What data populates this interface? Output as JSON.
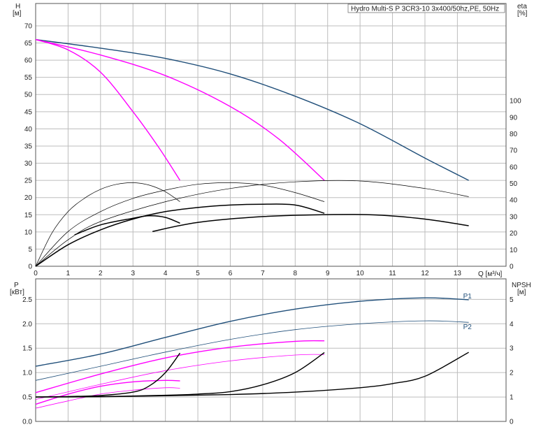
{
  "chart_data": [
    {
      "type": "line",
      "title": "Hydro Multi-S P 3CR3-10 3x400/50hz,PE, 50Hz",
      "xlabel": "Q [м³/ч]",
      "ylabel": "H",
      "ylabel_unit": "[м]",
      "y2label": "eta",
      "y2label_unit": "[%]",
      "xlim": [
        0,
        14.5
      ],
      "ylim": [
        0,
        76.5
      ],
      "y2lim": [
        0,
        100
      ],
      "x_ticks": [
        "0",
        "1",
        "2",
        "3",
        "4",
        "5",
        "6",
        "7",
        "8",
        "9",
        "10",
        "11",
        "12",
        "13"
      ],
      "y_ticks": [
        "0",
        "5",
        "10",
        "15",
        "20",
        "25",
        "30",
        "35",
        "40",
        "45",
        "50",
        "55",
        "60",
        "65",
        "70"
      ],
      "y2_ticks": [
        "0",
        "10",
        "20",
        "30",
        "40",
        "50",
        "60",
        "70",
        "80",
        "90",
        "100"
      ],
      "grid": true,
      "colors": {
        "head_main": "#1f4e79",
        "head_partial": "#ff00ff",
        "eta": "#000000"
      },
      "series": [
        {
          "role": "head",
          "x": [
            0,
            2,
            4,
            6,
            8,
            10,
            12,
            13.35
          ],
          "y": [
            66,
            63.5,
            60.5,
            56,
            49.5,
            41.5,
            31.5,
            25
          ]
        },
        {
          "role": "head",
          "x": [
            0,
            2,
            4,
            6,
            7.5,
            8.9
          ],
          "y": [
            66,
            61.5,
            55.5,
            46.5,
            37,
            25
          ]
        },
        {
          "role": "head",
          "x": [
            0,
            1,
            2,
            3,
            3.8,
            4.45
          ],
          "y": [
            66,
            63,
            56.5,
            45,
            34.5,
            25
          ]
        },
        {
          "role": "eta",
          "x": [
            0,
            1,
            2,
            4,
            6,
            8,
            10,
            12,
            13.35
          ],
          "y2": [
            0,
            16,
            27,
            39,
            47,
            51,
            51.5,
            47,
            42
          ]
        },
        {
          "role": "eta",
          "x": [
            0,
            1,
            2,
            3,
            4,
            5,
            6,
            7,
            8,
            8.9
          ],
          "y2": [
            0,
            21,
            33,
            41,
            46,
            49.5,
            50.5,
            49,
            44.5,
            39
          ]
        },
        {
          "role": "eta",
          "x": [
            0,
            0.5,
            1,
            1.5,
            2,
            2.5,
            3,
            3.5,
            4,
            4.45
          ],
          "y2": [
            0,
            20,
            33,
            41,
            46.5,
            49.5,
            50.5,
            49,
            45,
            39
          ]
        },
        {
          "role": "eta",
          "x": [
            0,
            1,
            2,
            3,
            4,
            5,
            6,
            7,
            8,
            8.9
          ],
          "y2": [
            0,
            13,
            22,
            28.5,
            33,
            35.5,
            37,
            37.5,
            37,
            32
          ]
        },
        {
          "role": "eta",
          "x": [
            1.2,
            2,
            3,
            3.5,
            4,
            4.45
          ],
          "y2": [
            19,
            25,
            29,
            30.5,
            29.5,
            26
          ]
        },
        {
          "role": "eta",
          "x": [
            3.6,
            5,
            7,
            9,
            10.5,
            12,
            13.35
          ],
          "y2": [
            21,
            26.5,
            30,
            31.2,
            31,
            28.5,
            24.5
          ]
        }
      ]
    },
    {
      "type": "line",
      "xlim": [
        0,
        14.5
      ],
      "ylabel": "P",
      "ylabel_unit": "[кВт]",
      "y2label": "NPSH",
      "y2label_unit": "[м]",
      "ylim": [
        0,
        2.92
      ],
      "y2lim": [
        0,
        5.84
      ],
      "y_ticks": [
        "0.0",
        "0.5",
        "1.0",
        "1.5",
        "2.0",
        "2.5"
      ],
      "y2_ticks": [
        "0",
        "1",
        "2",
        "3",
        "4",
        "5"
      ],
      "grid": true,
      "series": [
        {
          "name": "P1",
          "role": "power",
          "x": [
            0,
            2,
            4,
            6,
            8,
            10,
            12,
            13.35
          ],
          "y": [
            1.13,
            1.38,
            1.72,
            2.05,
            2.3,
            2.46,
            2.53,
            2.49
          ]
        },
        {
          "name": "P2",
          "role": "power",
          "x": [
            0,
            2,
            4,
            6,
            8,
            10,
            12,
            13.35
          ],
          "y": [
            0.84,
            1.13,
            1.42,
            1.68,
            1.88,
            2.0,
            2.06,
            2.03
          ]
        },
        {
          "role": "power",
          "x": [
            0,
            2,
            4,
            6,
            8,
            8.9
          ],
          "y": [
            0.59,
            0.97,
            1.3,
            1.52,
            1.64,
            1.65
          ]
        },
        {
          "role": "power",
          "x": [
            0,
            2,
            4,
            6,
            8,
            8.9
          ],
          "y": [
            0.45,
            0.76,
            1.04,
            1.24,
            1.36,
            1.37
          ]
        },
        {
          "role": "power",
          "x": [
            0,
            1,
            2,
            3,
            4,
            4.45
          ],
          "y": [
            0.35,
            0.56,
            0.72,
            0.81,
            0.84,
            0.83
          ]
        },
        {
          "role": "power",
          "x": [
            0,
            1,
            2,
            3,
            4,
            4.45
          ],
          "y": [
            0.27,
            0.42,
            0.56,
            0.64,
            0.69,
            0.68
          ]
        },
        {
          "role": "npsh",
          "x": [
            0,
            2,
            4,
            6,
            8,
            10,
            11,
            12,
            13.35
          ],
          "y2": [
            1.0,
            1.01,
            1.05,
            1.1,
            1.2,
            1.38,
            1.55,
            1.85,
            2.83
          ]
        },
        {
          "role": "npsh",
          "x": [
            0,
            2,
            4,
            5,
            6,
            7,
            8,
            8.9
          ],
          "y2": [
            1.0,
            1.02,
            1.07,
            1.12,
            1.22,
            1.5,
            2.0,
            2.82
          ]
        },
        {
          "role": "npsh",
          "x": [
            0,
            1,
            2,
            3,
            3.5,
            4,
            4.45
          ],
          "y2": [
            1.0,
            1.02,
            1.06,
            1.2,
            1.45,
            2.0,
            2.8
          ]
        }
      ]
    }
  ]
}
